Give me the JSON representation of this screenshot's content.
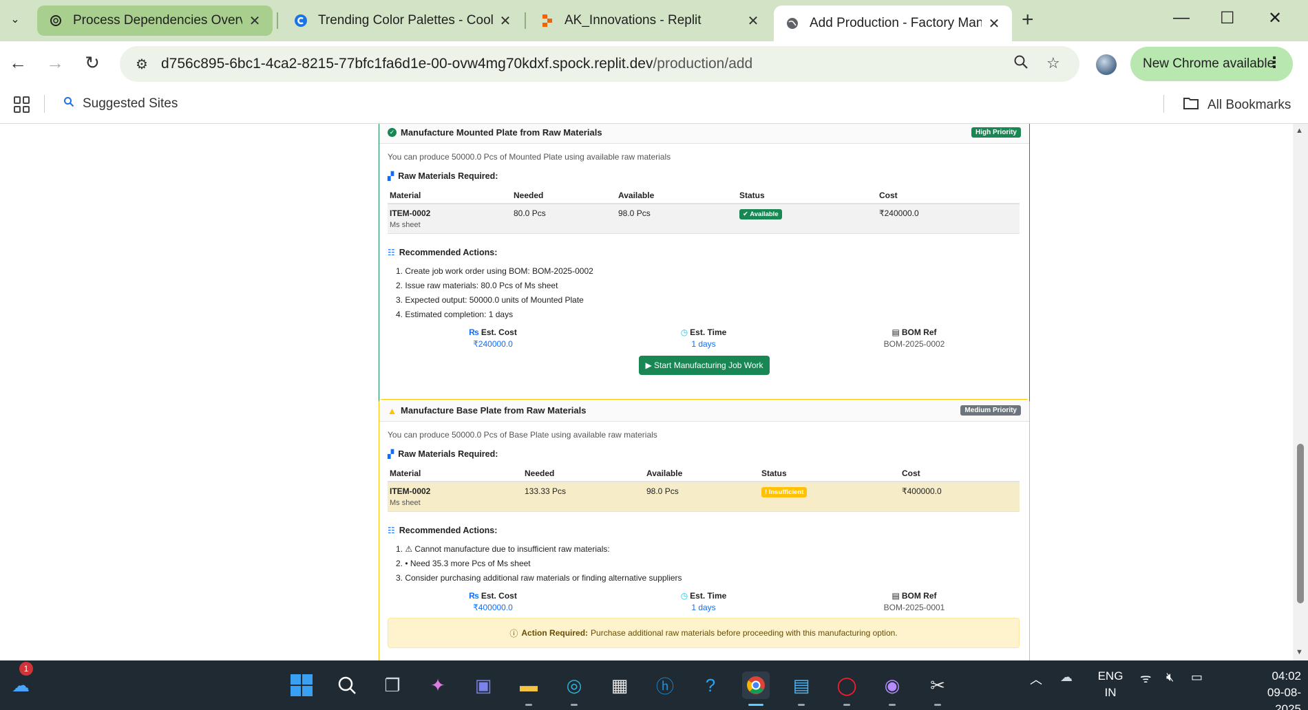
{
  "browser": {
    "tabs": [
      {
        "title": "Process Dependencies Overview",
        "icon": "openai-icon"
      },
      {
        "title": "Trending Color Palettes - Coolors",
        "icon": "coolors-icon"
      },
      {
        "title": "AK_Innovations - Replit",
        "icon": "replit-icon"
      },
      {
        "title": "Add Production - Factory Management",
        "icon": "globe-icon"
      }
    ],
    "url_host": "d756c895-6bc1-4ca2-8215-77bfc1fa6d1e-00-ovw4mg70kdxf.spock.replit.dev",
    "url_path": "/production/add",
    "update_label": "New Chrome available",
    "bookmarks": {
      "suggested": "Suggested Sites",
      "all": "All Bookmarks"
    }
  },
  "cards": [
    {
      "title": "Manufacture Mounted Plate from Raw Materials",
      "priority": "High Priority",
      "note": "You can produce 50000.0 Pcs of Mounted Plate using available raw materials",
      "materials_title": "Raw Materials Required:",
      "columns": [
        "Material",
        "Needed",
        "Available",
        "Status",
        "Cost"
      ],
      "row": {
        "code": "ITEM-0002",
        "name": "Ms sheet",
        "needed": "80.0 Pcs",
        "available": "98.0 Pcs",
        "status": "✔ Available",
        "cost": "₹240000.0"
      },
      "actions_title": "Recommended Actions:",
      "actions": [
        "1. Create job work order using BOM: BOM-2025-0002",
        "2. Issue raw materials: 80.0 Pcs of Ms sheet",
        "3. Expected output: 50000.0 units of Mounted Plate",
        "4. Estimated completion: 1 days"
      ],
      "stats": {
        "cost_label": "Est. Cost",
        "cost": "₹240000.0",
        "time_label": "Est. Time",
        "time": "1 days",
        "bom_label": "BOM Ref",
        "bom": "BOM-2025-0002"
      },
      "button": "▶ Start Manufacturing Job Work"
    },
    {
      "title": "Manufacture Base Plate from Raw Materials",
      "priority": "Medium Priority",
      "note": "You can produce 50000.0 Pcs of Base Plate using available raw materials",
      "materials_title": "Raw Materials Required:",
      "columns": [
        "Material",
        "Needed",
        "Available",
        "Status",
        "Cost"
      ],
      "row": {
        "code": "ITEM-0002",
        "name": "Ms sheet",
        "needed": "133.33 Pcs",
        "available": "98.0 Pcs",
        "status": "! Insufficient",
        "cost": "₹400000.0"
      },
      "actions_title": "Recommended Actions:",
      "actions": [
        "1. ⚠ Cannot manufacture due to insufficient raw materials:",
        "2. • Need 35.3 more Pcs of Ms sheet",
        "3. Consider purchasing additional raw materials or finding alternative suppliers"
      ],
      "stats": {
        "cost_label": "Est. Cost",
        "cost": "₹400000.0",
        "time_label": "Est. Time",
        "time": "1 days",
        "bom_label": "BOM Ref",
        "bom": "BOM-2025-0001"
      },
      "alert_strong": "Action Required:",
      "alert_text": "Purchase additional raw materials before proceeding with this manufacturing option."
    }
  ],
  "taskbar": {
    "notification_count": "1",
    "lang": "ENG",
    "region": "IN",
    "time": "04:02",
    "date": "09-08-2025"
  },
  "colors": {
    "success": "#198754",
    "warning": "#ffc107",
    "primary": "#0d6efd",
    "medium_badge": "#6c757d"
  }
}
